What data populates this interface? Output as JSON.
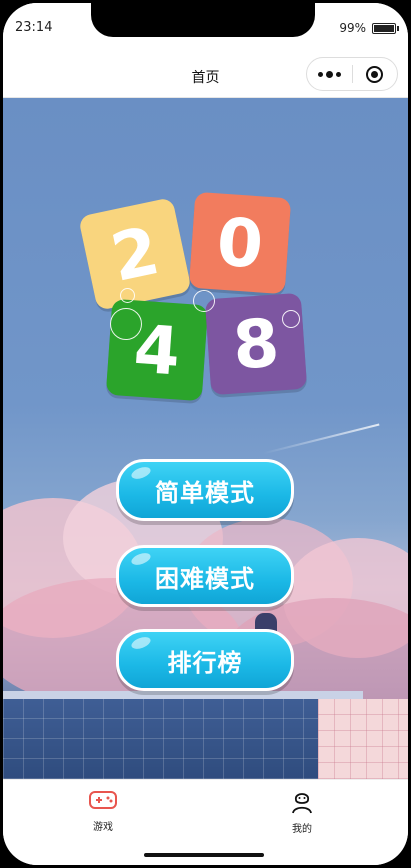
{
  "status_bar": {
    "time": "23:14",
    "battery": "99%"
  },
  "nav": {
    "title": "首页",
    "more_icon": "more-dots-icon",
    "close_icon": "target-circle-icon"
  },
  "logo": {
    "tiles": [
      "2",
      "0",
      "4",
      "8"
    ],
    "colors": [
      "#f9d57e",
      "#f27c5e",
      "#2ba42b",
      "#7d56a1"
    ]
  },
  "modes": [
    {
      "label": "简单模式"
    },
    {
      "label": "困难模式"
    },
    {
      "label": "排行榜"
    }
  ],
  "tab_bar": {
    "items": [
      {
        "label": "游戏",
        "icon": "gamepad-icon",
        "active": true
      },
      {
        "label": "我的",
        "icon": "user-icon",
        "active": false
      }
    ]
  },
  "colors": {
    "accent": "#1bb8e6",
    "tab_active": "#e8554e"
  }
}
